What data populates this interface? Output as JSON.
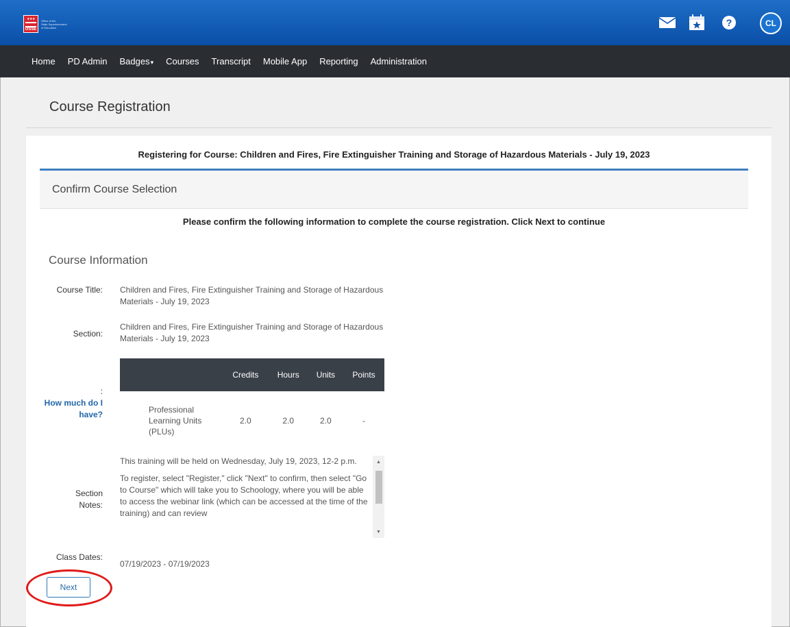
{
  "header": {
    "logo": {
      "abbr": "OSSE",
      "lines": [
        "Office of the",
        "State Superintendent",
        "of Education"
      ]
    },
    "icons": [
      "mail-icon",
      "calendar-star-icon",
      "help-icon"
    ],
    "avatar_initials": "CL",
    "brand_colors": {
      "topbar": "#0a4fa8",
      "navbar": "#2a2e33",
      "accent": "#3f7fc1",
      "highlight": "#e01b1b"
    }
  },
  "nav": {
    "items": [
      {
        "label": "Home"
      },
      {
        "label": "PD Admin"
      },
      {
        "label": "Badges"
      },
      {
        "label": "Courses"
      },
      {
        "label": "Transcript"
      },
      {
        "label": "Mobile App"
      },
      {
        "label": "Reporting"
      },
      {
        "label": "Administration"
      }
    ]
  },
  "page": {
    "title": "Course Registration",
    "registering_heading": "Registering for Course: Children and Fires, Fire Extinguisher Training and Storage of Hazardous Materials - July 19, 2023",
    "step_title": "Confirm Course Selection",
    "instruction": "Please confirm the following information to complete the course registration. Click Next to continue"
  },
  "course_info": {
    "heading": "Course Information",
    "course_title_label": "Course Title:",
    "course_title_value": "Children and Fires, Fire Extinguisher Training and Storage of Hazardous Materials - July 19, 2023",
    "section_label": "Section:",
    "section_value": "Children and Fires, Fire Extinguisher Training and Storage of Hazardous Materials - July 19, 2023",
    "credits_label": ":",
    "credits_link": "How much do I have?",
    "credits_table": {
      "columns": [
        "",
        "Credits",
        "Hours",
        "Units",
        "Points"
      ],
      "rows": [
        {
          "name": "Professional Learning Units (PLUs)",
          "credits": "2.0",
          "hours": "2.0",
          "units": "2.0",
          "points": "-"
        }
      ]
    },
    "notes_label": "Section Notes:",
    "notes_paragraphs": [
      "This training will be held on Wednesday, July 19, 2023, 12-2 p.m.",
      "To register, select \"Register,\" click \"Next\" to confirm, then select \"Go to Course\" which will take you to Schoology, where you will be able to access the webinar link (which can be accessed at the time of the training) and can review"
    ],
    "class_dates_label": "Class Dates:",
    "class_dates_value": "07/19/2023 - 07/19/2023"
  },
  "actions": {
    "next_label": "Next"
  }
}
